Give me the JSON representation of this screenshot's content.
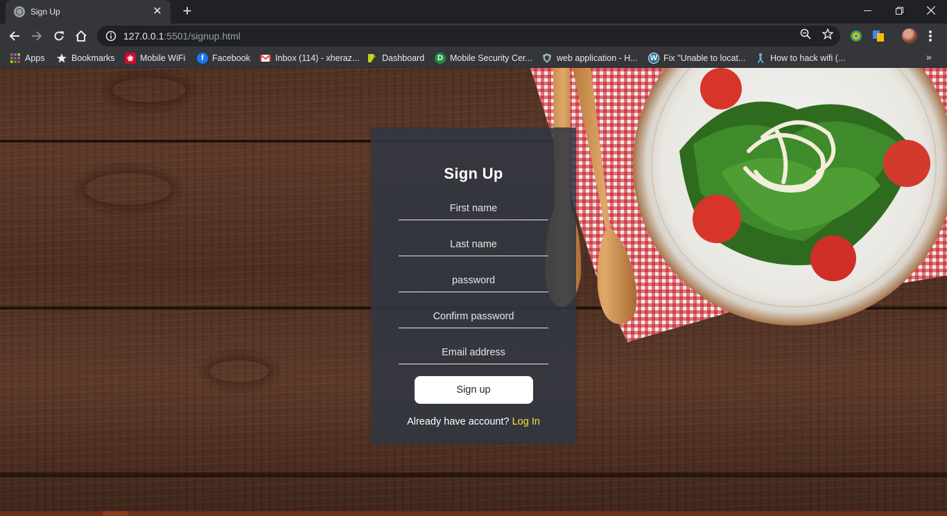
{
  "browser": {
    "tab": {
      "title": "Sign Up",
      "close_glyph": "✕",
      "favicon": "globe-icon"
    },
    "new_tab_glyph": "+",
    "window_controls": {
      "minimize": "minimize-icon",
      "restore": "restore-icon",
      "close": "close-window-icon"
    },
    "toolbar": {
      "back": "back-arrow-icon",
      "forward": "forward-arrow-icon",
      "reload": "reload-icon",
      "home": "home-icon",
      "url_host": "127.0.0.1",
      "url_rest": ":5501/signup.html",
      "site_info": "info-icon",
      "zoom": "zoom-icon",
      "bookmark_star": "star-icon"
    },
    "bookmarks": [
      {
        "label": "Apps",
        "icon": "apps-grid-icon"
      },
      {
        "label": "Bookmarks",
        "icon": "star-icon"
      },
      {
        "label": "Mobile WiFi",
        "icon": "huawei-icon"
      },
      {
        "label": "Facebook",
        "icon": "facebook-icon"
      },
      {
        "label": "Inbox (114) - xheraz...",
        "icon": "gmail-icon"
      },
      {
        "label": "Dashboard",
        "icon": "dashboard-icon"
      },
      {
        "label": "Mobile Security Cer...",
        "icon": "d-icon"
      },
      {
        "label": "web application - H...",
        "icon": "shield-icon"
      },
      {
        "label": "Fix \"Unable to locat...",
        "icon": "wordpress-icon"
      },
      {
        "label": "How to hack wifi (...",
        "icon": "figure-icon"
      }
    ],
    "bookmarks_overflow": "»"
  },
  "signup": {
    "title": "Sign Up",
    "fields": [
      {
        "placeholder": "First name",
        "value": ""
      },
      {
        "placeholder": "Last name",
        "value": ""
      },
      {
        "placeholder": "password",
        "value": ""
      },
      {
        "placeholder": "Confirm password",
        "value": ""
      },
      {
        "placeholder": "Email address",
        "value": ""
      }
    ],
    "submit_label": "Sign up",
    "login_prompt": "Already have account?",
    "login_link": "Log In"
  },
  "colors": {
    "chrome_dark": "#202124",
    "chrome_toolbar": "#35363a",
    "form_panel": "#303742",
    "link_yellow": "#f2e23b",
    "wood": "#543324"
  }
}
